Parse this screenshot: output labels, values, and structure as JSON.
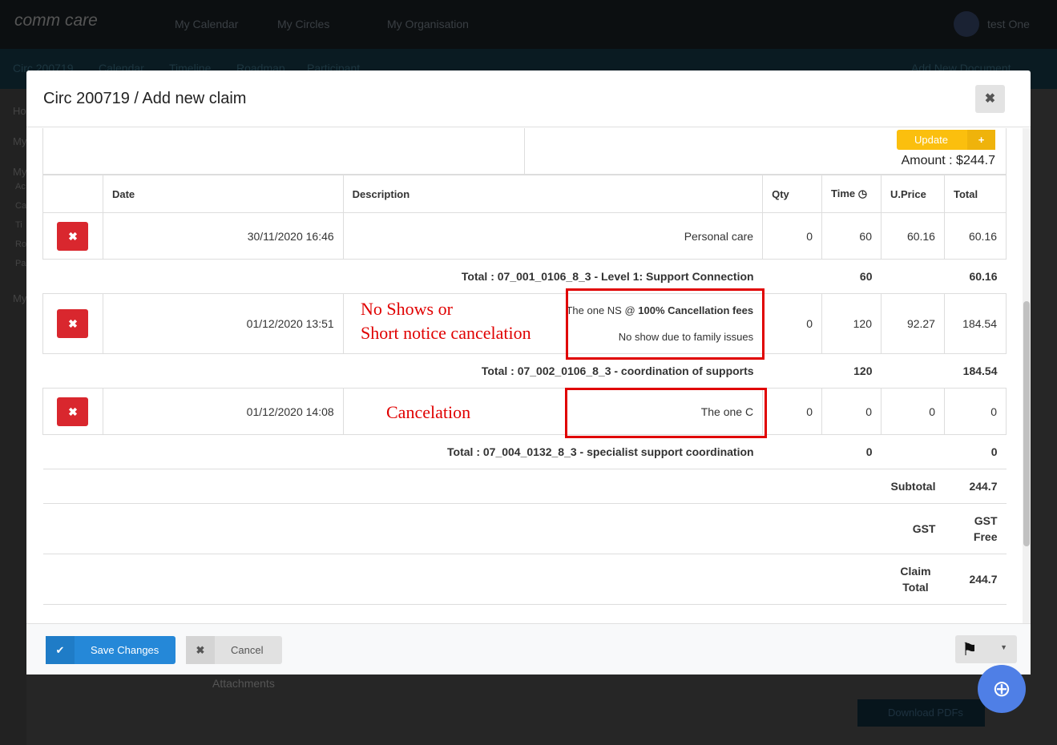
{
  "topbar": {
    "logo": "comm care",
    "nav": [
      "My Calendar",
      "My Circles",
      "My Organisation"
    ],
    "user": "test One"
  },
  "subbar": {
    "items": [
      "Circ 200719",
      "Calendar",
      "Timeline",
      "Roadmap",
      "Participant"
    ],
    "add_doc": "Add New Document"
  },
  "sidebar": [
    "Ho",
    "My",
    "My",
    "Ac",
    "Ca",
    "Ti",
    "Ro",
    "Pa",
    "My"
  ],
  "background": {
    "attachments": "Attachments",
    "download": "Download PDFs"
  },
  "modal": {
    "title": "Circ 200719 / Add new claim",
    "update_label": "Update",
    "amount": "Amount : $244.7"
  },
  "table": {
    "headers": [
      "",
      "Date",
      "Description",
      "Qty",
      "Time",
      "U.Price",
      "Total"
    ],
    "rows": [
      {
        "date": "30/11/2020 16:46",
        "desc": "Personal care",
        "desc2": "",
        "qty": "0",
        "time": "60",
        "uprice": "60.16",
        "total": "60.16",
        "sum_label": "Total : 07_001_0106_8_3 - Level 1: Support Connection",
        "sum_time": "60",
        "sum_total": "60.16"
      },
      {
        "date": "01/12/2020 13:51",
        "desc_prefix": "The one NS @ ",
        "desc_bold": "100% Cancellation fees",
        "desc2": "No show due to family issues",
        "qty": "0",
        "time": "120",
        "uprice": "92.27",
        "total": "184.54",
        "sum_label": "Total : 07_002_0106_8_3 - coordination of supports",
        "sum_time": "120",
        "sum_total": "184.54"
      },
      {
        "date": "01/12/2020 14:08",
        "desc": "The one C",
        "qty": "0",
        "time": "0",
        "uprice": "0",
        "total": "0",
        "sum_label": "Total : 07_004_0132_8_3 - specialist support coordination",
        "sum_time": "0",
        "sum_total": "0"
      }
    ],
    "subtotal_label": "Subtotal",
    "subtotal": "244.7",
    "gst_label": "GST",
    "gst": "GST Free",
    "claim_total_label": "Claim Total",
    "claim_total": "244.7"
  },
  "annotations": {
    "no_shows": "No Shows or",
    "short_notice": "Short notice cancelation",
    "cancelation": "Cancelation",
    "color": "#e00000"
  },
  "footer": {
    "save": "Save Changes",
    "cancel": "Cancel"
  }
}
